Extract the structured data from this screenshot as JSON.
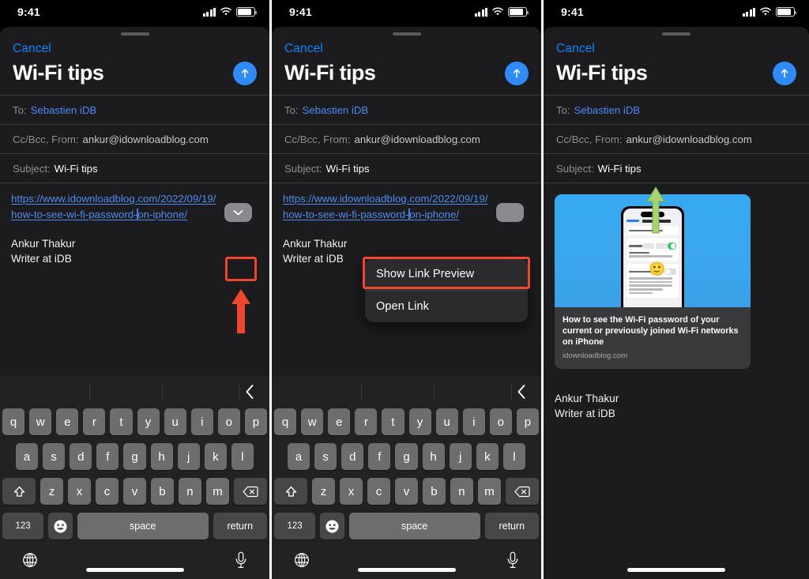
{
  "status": {
    "time": "9:41",
    "signal_icon": "cellular-bars-icon",
    "wifi_icon": "wifi-icon",
    "battery_icon": "battery-icon"
  },
  "compose": {
    "cancel_label": "Cancel",
    "title": "Wi-Fi tips",
    "send_icon": "send-arrow-up-icon",
    "to_label": "To:",
    "to_value": "Sebastien iDB",
    "ccbcc_label": "Cc/Bcc, From:",
    "ccbcc_value": "ankur@idownloadblog.com",
    "subject_label": "Subject:",
    "subject_value": "Wi-Fi tips",
    "url_line1": "https://www.idownloadblog.com/2022/09/19/",
    "url_line2": "how-to-see-wi-fi-password-",
    "url_line2b": "on-iphone/",
    "signature_line1": "Ankur Thakur",
    "signature_line2": "Writer at iDB",
    "signature_emoji": "🙂",
    "chevron_icon": "chevron-down-icon"
  },
  "context_menu": {
    "items": [
      {
        "label": "Show Link Preview",
        "highlighted": true
      },
      {
        "label": "Open Link",
        "highlighted": false
      }
    ]
  },
  "link_preview": {
    "title": "How to see the Wi-Fi password of your current or previously joined Wi-Fi networks on iPhone",
    "source": "idownloadblog.com",
    "image_alt": "iphone-wifi-settings-screenshot"
  },
  "annotations": {
    "red_box_target": "chevron-down-button",
    "red_arrow_icon": "red-up-arrow-icon",
    "green_arrow_icon": "green-up-arrow-icon",
    "red_color": "#f0462d",
    "green_color": "#a8d46f"
  },
  "keyboard": {
    "pred_back_icon": "chevron-left-icon",
    "row1": [
      "q",
      "w",
      "e",
      "r",
      "t",
      "y",
      "u",
      "i",
      "o",
      "p"
    ],
    "row2": [
      "a",
      "s",
      "d",
      "f",
      "g",
      "h",
      "j",
      "k",
      "l"
    ],
    "row3": [
      "z",
      "x",
      "c",
      "v",
      "b",
      "n",
      "m"
    ],
    "shift_icon": "shift-up-icon",
    "backspace_icon": "backspace-delete-icon",
    "numbers_key": "123",
    "emoji_key_icon": "emoji-smiley-icon",
    "space_key": "space",
    "return_key": "return",
    "globe_icon": "globe-language-icon",
    "mic_icon": "microphone-dictation-icon"
  }
}
